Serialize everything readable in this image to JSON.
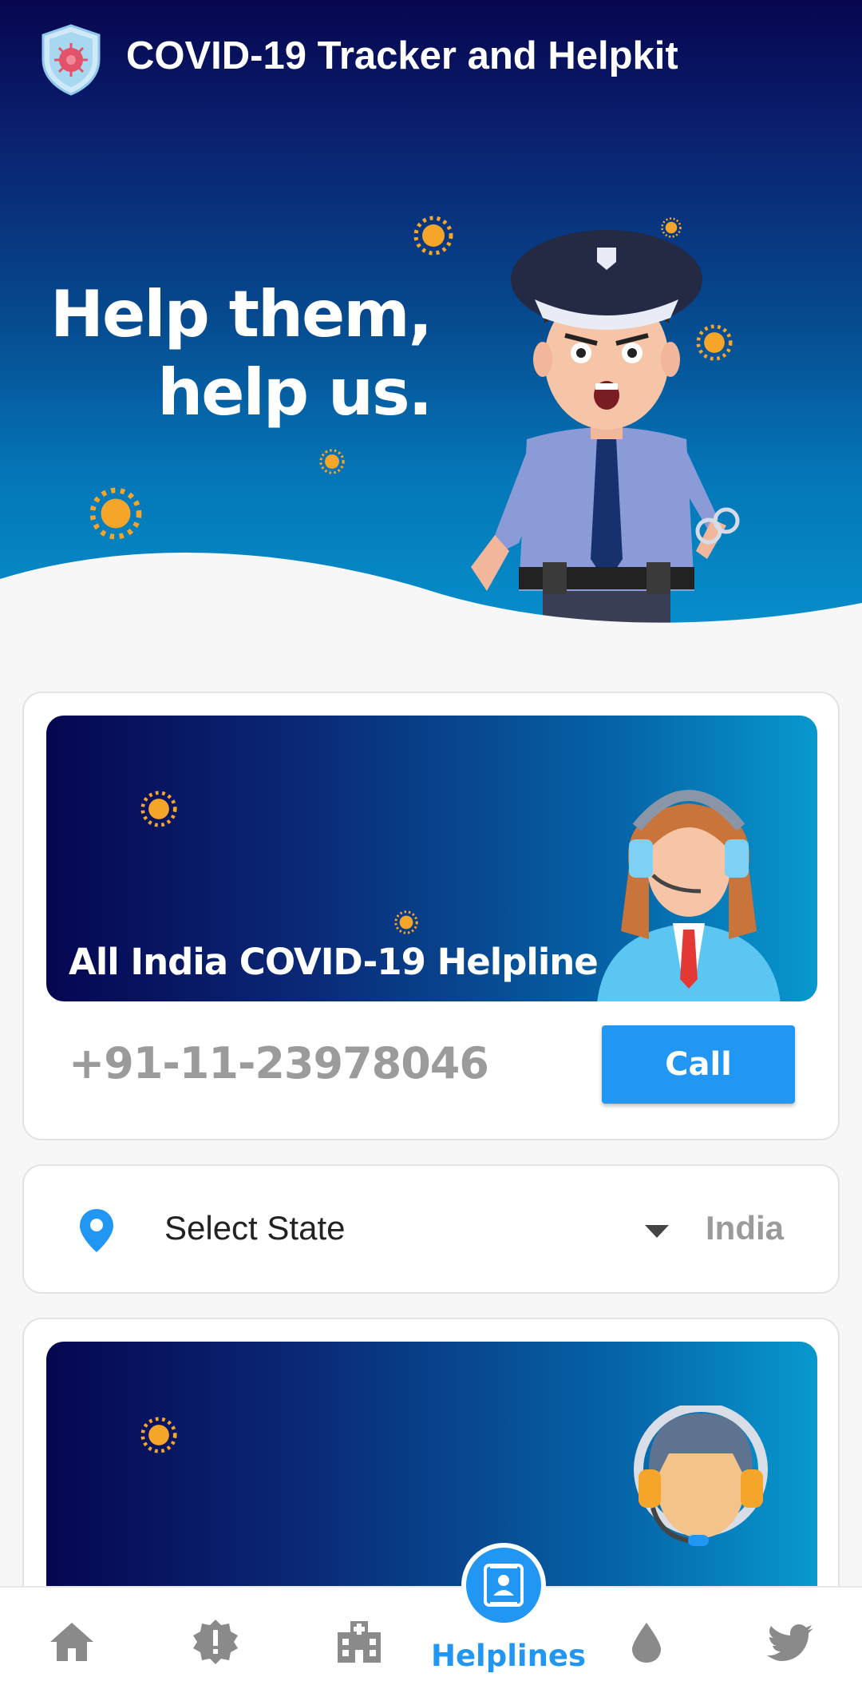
{
  "header": {
    "app_title": "COVID-19 Tracker and Helpkit",
    "hero_line1": "Help them,",
    "hero_line2": "help us."
  },
  "national_helpline": {
    "title": "All India COVID-19 Helpline",
    "phone": "+91-11-23978046",
    "call_label": "Call"
  },
  "state_selector": {
    "placeholder": "Select State",
    "country": "India"
  },
  "bottom_nav": {
    "items": [
      {
        "icon": "home-icon"
      },
      {
        "icon": "alert-badge-icon"
      },
      {
        "icon": "hospital-icon"
      },
      {
        "icon": "helplines-icon",
        "label": "Helplines",
        "active": true
      },
      {
        "icon": "blood-drop-icon"
      },
      {
        "icon": "twitter-icon"
      }
    ]
  },
  "colors": {
    "accent": "#2196f3",
    "header_dark": "#07064f",
    "header_light": "#0790cc",
    "virus": "#f5a62a",
    "muted_text": "#9b9b9b"
  }
}
